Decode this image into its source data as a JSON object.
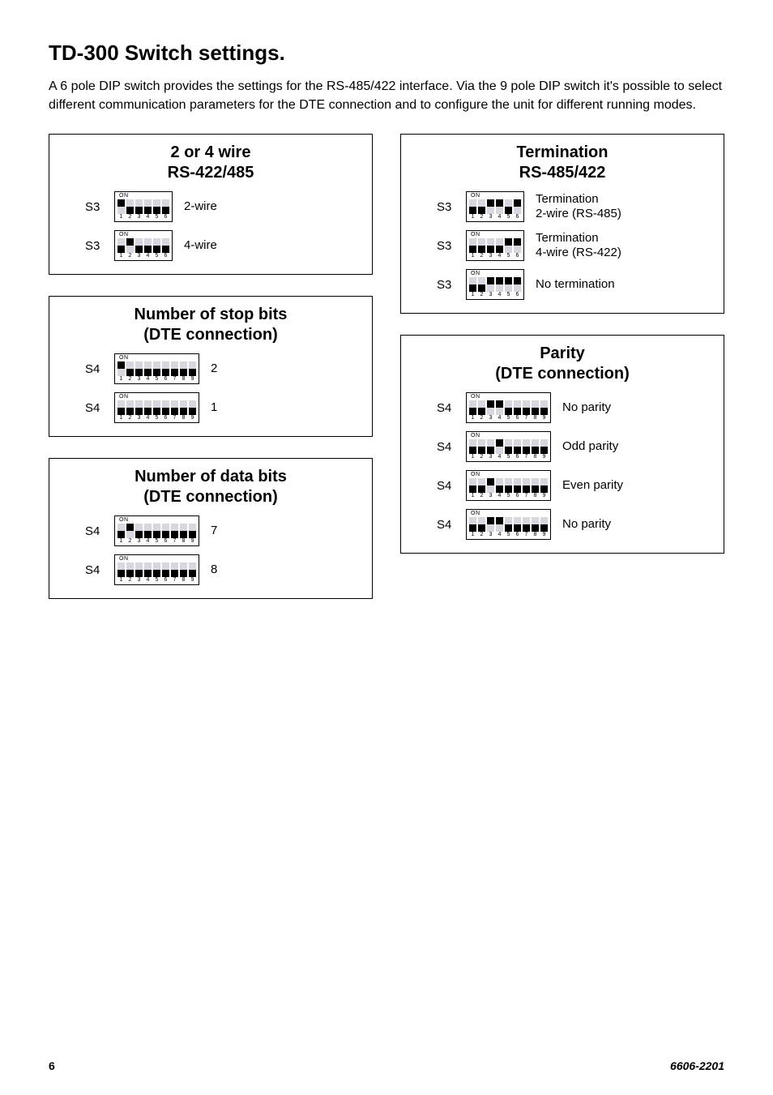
{
  "title": "TD-300 Switch settings.",
  "intro": "A 6 pole DIP switch provides the settings for the RS-485/422 interface. Via the 9 pole DIP switch it's possible to select different communication parameters for the DTE connection and to configure the unit for different running modes.",
  "panels": {
    "wire": {
      "title_line1": "2 or 4 wire",
      "title_line2": "RS-422/485",
      "rows": [
        {
          "left": "S3",
          "poles": 6,
          "pattern": [
            "up",
            "down",
            "down",
            "down",
            "down",
            "down"
          ],
          "right": "2-wire"
        },
        {
          "left": "S3",
          "poles": 6,
          "pattern": [
            "down",
            "up",
            "down",
            "down",
            "down",
            "down"
          ],
          "right": "4-wire"
        }
      ]
    },
    "stopbits": {
      "title_line1": "Number of stop bits",
      "title_line2": "(DTE connection)",
      "rows": [
        {
          "left": "S4",
          "poles": 9,
          "pattern": [
            "up",
            "down",
            "down",
            "down",
            "down",
            "down",
            "down",
            "down",
            "down"
          ],
          "right": "2"
        },
        {
          "left": "S4",
          "poles": 9,
          "pattern": [
            "down",
            "down",
            "down",
            "down",
            "down",
            "down",
            "down",
            "down",
            "down"
          ],
          "right": "1"
        }
      ]
    },
    "databits": {
      "title_line1": "Number of data bits",
      "title_line2": "(DTE connection)",
      "rows": [
        {
          "left": "S4",
          "poles": 9,
          "pattern": [
            "down",
            "up",
            "down",
            "down",
            "down",
            "down",
            "down",
            "down",
            "down"
          ],
          "right": "7"
        },
        {
          "left": "S4",
          "poles": 9,
          "pattern": [
            "down",
            "down",
            "down",
            "down",
            "down",
            "down",
            "down",
            "down",
            "down"
          ],
          "right": "8"
        }
      ]
    },
    "termination": {
      "title_line1": "Termination",
      "title_line2": "RS-485/422",
      "rows": [
        {
          "left": "S3",
          "poles": 6,
          "pattern": [
            "down",
            "down",
            "up",
            "up",
            "down",
            "up"
          ],
          "right_line1": "Termination",
          "right_line2": "2-wire (RS-485)"
        },
        {
          "left": "S3",
          "poles": 6,
          "pattern": [
            "down",
            "down",
            "down",
            "down",
            "up",
            "up"
          ],
          "right_line1": "Termination",
          "right_line2": "4-wire (RS-422)"
        },
        {
          "left": "S3",
          "poles": 6,
          "pattern": [
            "down",
            "down",
            "up",
            "up",
            "up",
            "up"
          ],
          "right_line1": "No termination",
          "right_line2": ""
        }
      ]
    },
    "parity": {
      "title_line1": "Parity",
      "title_line2": "(DTE connection)",
      "rows": [
        {
          "left": "S4",
          "poles": 9,
          "pattern": [
            "down",
            "down",
            "up",
            "up",
            "down",
            "down",
            "down",
            "down",
            "down"
          ],
          "right": "No parity"
        },
        {
          "left": "S4",
          "poles": 9,
          "pattern": [
            "down",
            "down",
            "down",
            "up",
            "down",
            "down",
            "down",
            "down",
            "down"
          ],
          "right": "Odd parity"
        },
        {
          "left": "S4",
          "poles": 9,
          "pattern": [
            "down",
            "down",
            "up",
            "down",
            "down",
            "down",
            "down",
            "down",
            "down"
          ],
          "right": "Even parity"
        },
        {
          "left": "S4",
          "poles": 9,
          "pattern": [
            "down",
            "down",
            "up",
            "up",
            "down",
            "down",
            "down",
            "down",
            "down"
          ],
          "right": "No parity"
        }
      ]
    }
  },
  "dip_on_label": "ON",
  "footer": {
    "page": "6",
    "doc": "6606-2201"
  }
}
